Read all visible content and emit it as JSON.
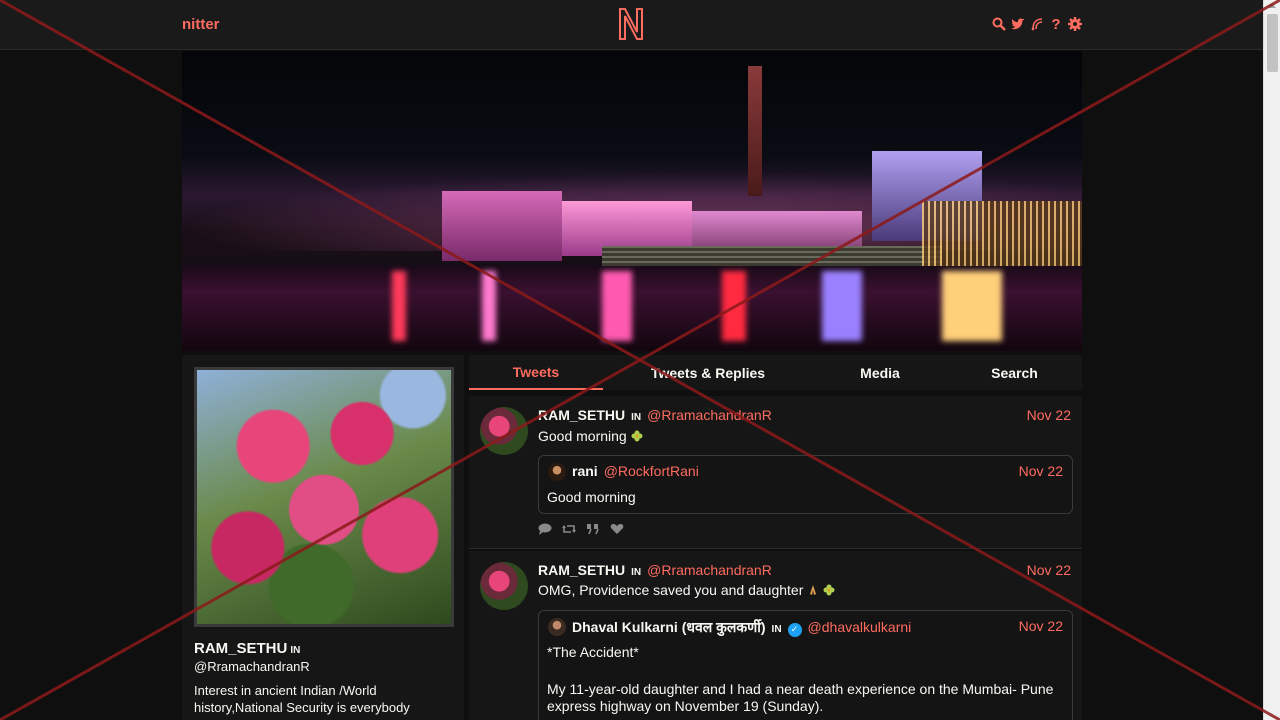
{
  "nav": {
    "logo_text": "nitter",
    "icons": [
      "search-icon",
      "twitter-icon",
      "rss-icon",
      "help-icon",
      "settings-icon"
    ],
    "help_glyph": "?"
  },
  "colors": {
    "accent": "#ff6c60",
    "bg": "#0f0f0f",
    "panel": "#161616",
    "text": "#f8f8f2"
  },
  "profile": {
    "fullname": "RAM_SETHU",
    "flag": "IN",
    "username": "@RramachandranR",
    "bio": "Interest in ancient Indian /World history,National Security is everybody"
  },
  "tabs": [
    {
      "label": "Tweets",
      "active": true
    },
    {
      "label": "Tweets & Replies",
      "active": false
    },
    {
      "label": "Media",
      "active": false
    },
    {
      "label": "Search",
      "active": false
    }
  ],
  "tweets": [
    {
      "fullname": "RAM_SETHU",
      "flag": "IN",
      "username": "@RramachandranR",
      "date": "Nov 22",
      "text": "Good morning",
      "quote": {
        "fullname": "rani",
        "username": "@RockfortRani",
        "date": "Nov 22",
        "text": "Good morning"
      }
    },
    {
      "fullname": "RAM_SETHU",
      "flag": "IN",
      "username": "@RramachandranR",
      "date": "Nov 22",
      "text": "OMG, Providence saved you and daughter",
      "quote": {
        "fullname": "Dhaval Kulkarni (धवल कुलकर्णी)",
        "flag": "IN",
        "username": "@dhavalkulkarni",
        "date": "Nov 22",
        "line1": "*The Accident*",
        "line2": "My 11-year-old daughter and I had a near death experience on the Mumbai- Pune",
        "line3": "express highway on November 19 (Sunday)."
      }
    }
  ]
}
